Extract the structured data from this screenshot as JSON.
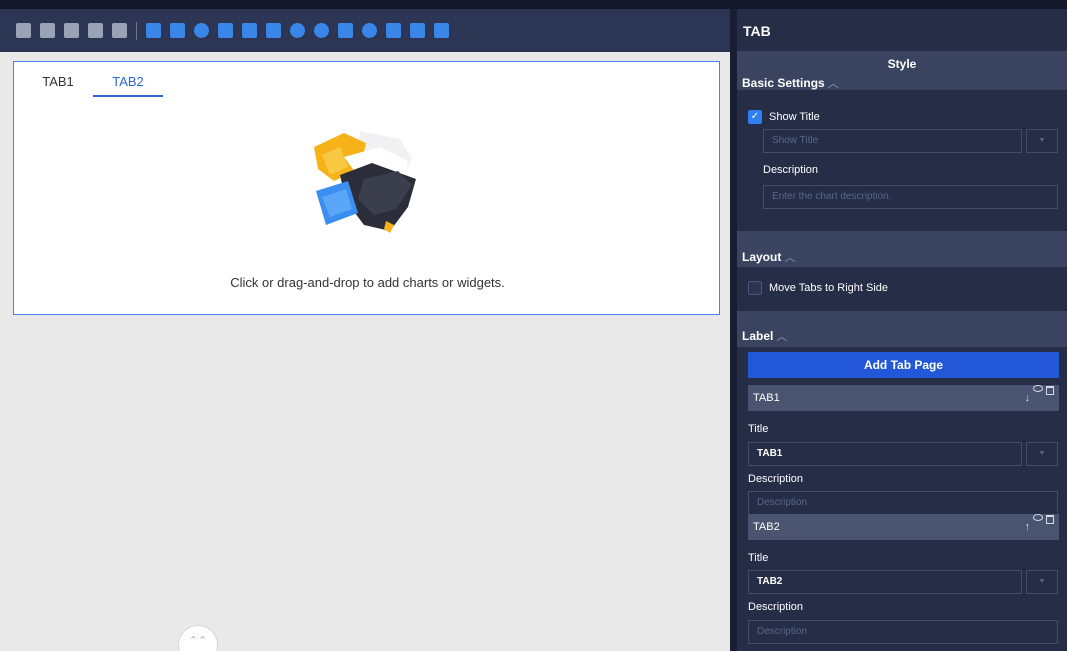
{
  "toolbar": {
    "icons": [
      "query-icon",
      "text-icon",
      "link-icon",
      "video-icon",
      "image-icon",
      "line-chart-icon",
      "bar-chart-icon",
      "pie-chart-icon",
      "table-icon",
      "map-icon",
      "list-icon",
      "gauge-icon",
      "bubble-icon",
      "funnel-icon",
      "radar-icon",
      "card-icon",
      "filter-icon",
      "tree-icon"
    ]
  },
  "canvas": {
    "tabs": [
      {
        "label": "TAB1"
      },
      {
        "label": "TAB2"
      }
    ],
    "active_tab": "TAB2",
    "empty_message": "Click or drag-and-drop to add charts or widgets.",
    "collapse_glyph": "⌃⌃"
  },
  "panel": {
    "title": "TAB",
    "style_tab": "Style",
    "basic_settings": {
      "header": "Basic Settings",
      "show_title_label": "Show Title",
      "show_title_checked": true,
      "title_placeholder": "Show Title",
      "description_label": "Description",
      "description_placeholder": "Enter the chart description."
    },
    "layout": {
      "header": "Layout",
      "move_tabs_label": "Move Tabs to Right Side",
      "move_tabs_checked": false
    },
    "label": {
      "header": "Label",
      "add_tab_button": "Add Tab Page",
      "tab_items": [
        {
          "name": "TAB1",
          "arrow": "↓",
          "title_label": "Title",
          "title_value": "TAB1",
          "description_label": "Description",
          "description_placeholder": "Description"
        },
        {
          "name": "TAB2",
          "arrow": "↑",
          "title_label": "Title",
          "title_value": "TAB2",
          "description_label": "Description",
          "description_placeholder": "Description"
        }
      ]
    },
    "chevron_glyph": "︿",
    "dropdown_glyph": "▼"
  },
  "colors": {
    "toolbar_bg": "#2c3553",
    "panel_bg": "#252d47",
    "section_bg": "#3a4460",
    "accent": "#2257d7",
    "tab_active": "#2e65d8",
    "checkbox": "#2f7ff0"
  }
}
